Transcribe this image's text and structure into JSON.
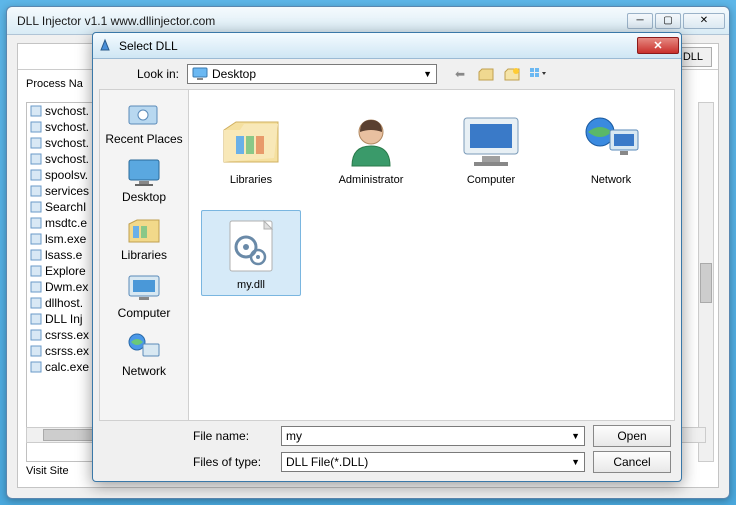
{
  "main_window": {
    "title": "DLL Injector v1.1  www.dllinjector.com",
    "toolbar_button": "ct DLL",
    "process_header": "Process Na",
    "processes": [
      "svchost.",
      "svchost.",
      "svchost.",
      "svchost.",
      "spoolsv.",
      "services",
      "SearchI",
      "msdtc.e",
      "lsm.exe",
      "lsass.e",
      "Explore",
      "Dwm.ex",
      "dllhost.",
      "DLL Inj",
      "csrss.ex",
      "csrss.ex",
      "calc.exe"
    ],
    "footer": "Visit Site"
  },
  "dialog": {
    "title": "Select DLL",
    "look_in_label": "Look in:",
    "look_in_value": "Desktop",
    "places": [
      "Recent Places",
      "Desktop",
      "Libraries",
      "Computer",
      "Network"
    ],
    "items": [
      {
        "name": "Libraries",
        "icon": "folder"
      },
      {
        "name": "Administrator",
        "icon": "user"
      },
      {
        "name": "Computer",
        "icon": "computer"
      },
      {
        "name": "Network",
        "icon": "network"
      },
      {
        "name": "my.dll",
        "icon": "dll",
        "selected": true
      }
    ],
    "file_name_label": "File name:",
    "file_name_value": "my",
    "file_type_label": "Files of type:",
    "file_type_value": "DLL File(*.DLL)",
    "open_btn": "Open",
    "cancel_btn": "Cancel"
  }
}
